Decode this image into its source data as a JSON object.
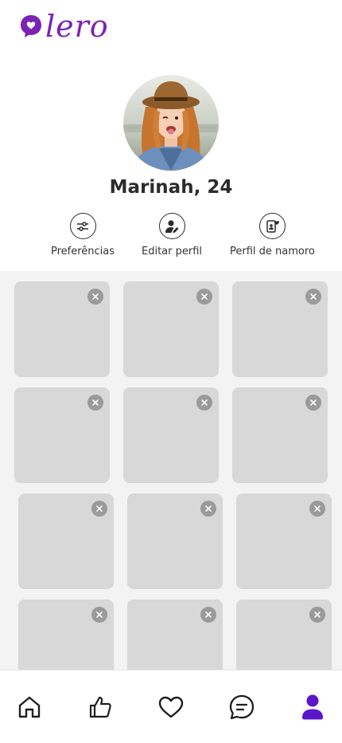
{
  "app": {
    "name": "lero",
    "brand_color": "#7c22b5",
    "accent_color": "#5b16c9"
  },
  "profile": {
    "name_age": "Marinah, 24"
  },
  "actions": [
    {
      "label": "Preferências",
      "icon": "sliders-icon"
    },
    {
      "label": "Editar perfil",
      "icon": "edit-profile-icon"
    },
    {
      "label": "Perfil de namoro",
      "icon": "dating-profile-icon"
    }
  ],
  "photo_slots": {
    "count": 12,
    "empty_color": "#d8d8d8"
  },
  "bottom_nav": {
    "items": [
      "home-icon",
      "thumbs-up-icon",
      "heart-icon",
      "chat-icon",
      "profile-icon"
    ],
    "active": "profile-icon"
  }
}
